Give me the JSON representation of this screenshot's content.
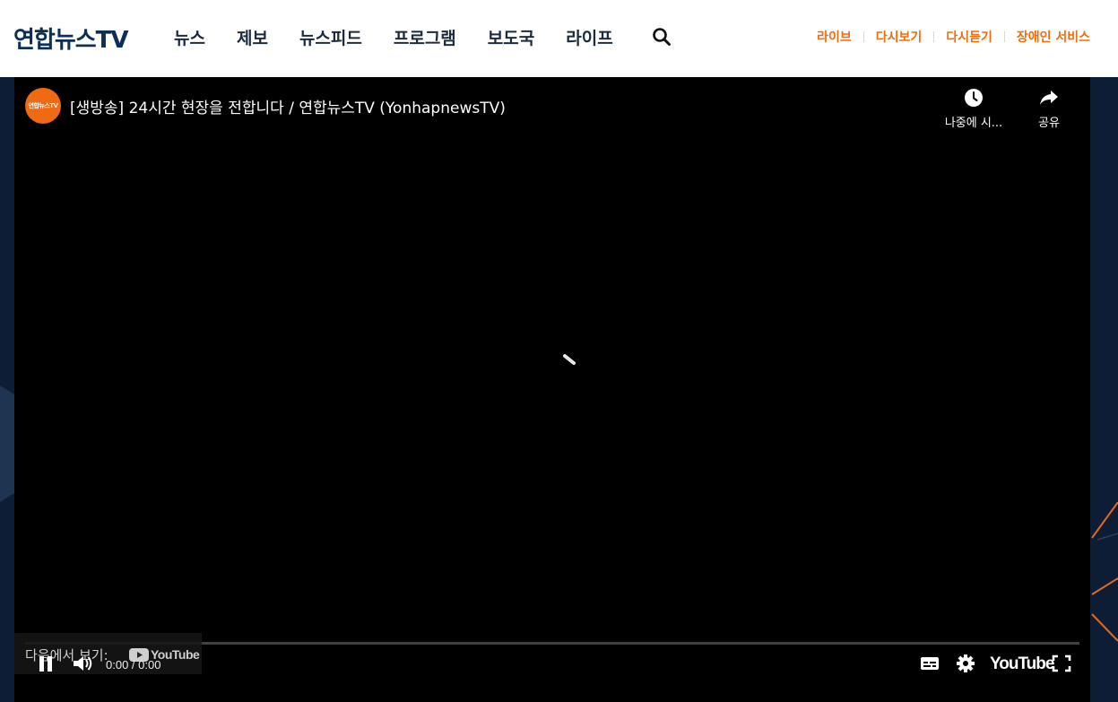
{
  "header": {
    "logo": "연합뉴스TV",
    "nav": [
      "뉴스",
      "제보",
      "뉴스피드",
      "프로그램",
      "보도국",
      "라이프"
    ],
    "search_icon": "search-icon",
    "utility": [
      "라이브",
      "다시보기",
      "다시듣기",
      "장애인 서비스"
    ],
    "utility_color": "#f06d0b",
    "brand_color": "#0c2f56"
  },
  "player": {
    "channel_avatar_text": "연합뉴스TV",
    "title": "[생방송] 24시간 현장을 전합니다 / 연합뉴스TV (YonhapnewsTV)",
    "watch_later_label": "나중에 시...",
    "share_label": "공유",
    "watch_on_label": "다음에서 보기:",
    "watch_on_brand": "YouTube",
    "time": "0:00 / 0:00",
    "youtube_logo": "YouTube",
    "icons": [
      "clock-icon",
      "share-icon",
      "pause-icon",
      "volume-icon",
      "subtitles-icon",
      "settings-icon",
      "fullscreen-icon",
      "loading-spinner-icon"
    ]
  }
}
